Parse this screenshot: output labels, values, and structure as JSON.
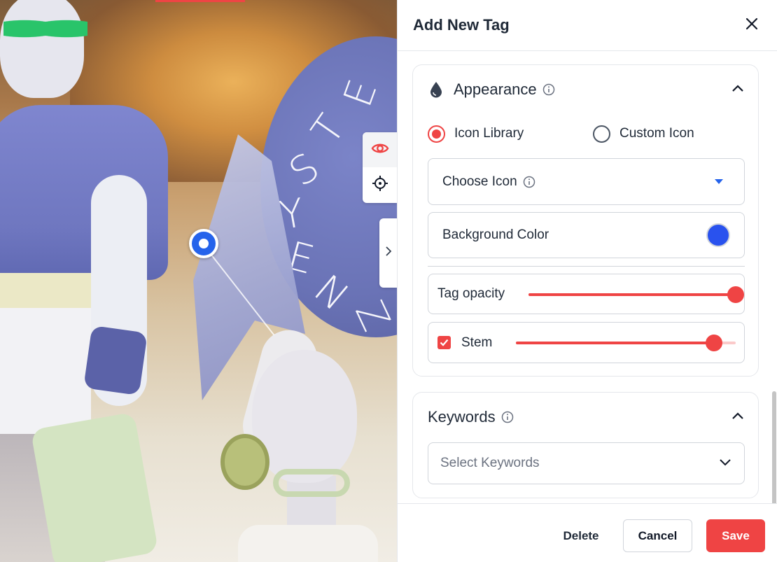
{
  "panel": {
    "title": "Add New Tag"
  },
  "appearance": {
    "title": "Appearance",
    "icon_source": {
      "options": [
        "Icon Library",
        "Custom Icon"
      ],
      "selected": "Icon Library"
    },
    "choose_icon_label": "Choose Icon",
    "background_color_label": "Background Color",
    "background_color": "#2952ee",
    "tag_opacity_label": "Tag opacity",
    "tag_opacity_value": 1.0,
    "stem_label": "Stem",
    "stem_checked": true,
    "stem_value": 0.9
  },
  "keywords": {
    "title": "Keywords",
    "placeholder": "Select Keywords"
  },
  "footer": {
    "delete_label": "Delete",
    "cancel_label": "Cancel",
    "save_label": "Save"
  },
  "viewer": {
    "sign_letters": [
      "E",
      "T",
      "S",
      "Y",
      "E",
      "N",
      "Z"
    ]
  },
  "colors": {
    "accent": "#ef4444",
    "hotspot": "#2563eb",
    "dropdown_caret": "#2563eb"
  },
  "icons": {
    "close": "close-icon",
    "appearance": "droplet-icon",
    "info": "info-icon",
    "collapse": "chevron-up-icon",
    "view": "eye-icon",
    "target": "crosshair-icon",
    "expand": "chevron-right-icon",
    "dropdown": "chevron-down-icon"
  }
}
